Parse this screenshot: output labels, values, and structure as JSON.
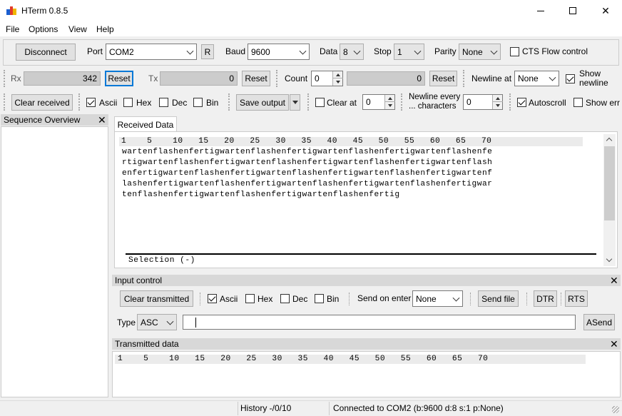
{
  "window": {
    "title": "HTerm 0.8.5",
    "minimize": "—",
    "maximize": "☐",
    "close": "✕"
  },
  "menu": [
    "File",
    "Options",
    "View",
    "Help"
  ],
  "connection": {
    "disconnect": "Disconnect",
    "port_label": "Port",
    "port_value": "COM2",
    "r_button": "R",
    "baud_label": "Baud",
    "baud_value": "9600",
    "data_label": "Data",
    "data_value": "8",
    "stop_label": "Stop",
    "stop_value": "1",
    "parity_label": "Parity",
    "parity_value": "None",
    "cts_label": "CTS Flow control",
    "cts_checked": false
  },
  "counters": {
    "rx_label": "Rx",
    "rx_value": "342",
    "rx_reset": "Reset",
    "tx_label": "Tx",
    "tx_value": "0",
    "tx_reset": "Reset",
    "count_label": "Count",
    "count_value": "0",
    "count_display": "0",
    "count_reset": "Reset",
    "newline_label": "Newline at",
    "newline_value": "None",
    "show_newline_label": "Show newline",
    "show_newline_checked": true
  },
  "receive_toolbar": {
    "clear_received": "Clear received",
    "ascii": "Ascii",
    "ascii_checked": true,
    "hex": "Hex",
    "dec": "Dec",
    "bin": "Bin",
    "save_output": "Save output",
    "clear_at_label": "Clear at",
    "clear_at_value": "0",
    "newline_every_label": "Newline every ... characters",
    "newline_every_value": "0",
    "autoscroll": "Autoscroll",
    "autoscroll_checked": true,
    "show_err": "Show err"
  },
  "sequence_overview": {
    "title": "Sequence Overview"
  },
  "received": {
    "tab": "Received Data",
    "ruler": "1    5    10   15   20   25   30   35   40   45   50   55   60   65   70",
    "lines": [
      "wartenflashenfertigwartenflashenfertigwartenflashenfertigwartenflashenfe",
      "rtigwartenflashenfertigwartenflashenfertigwartenflashenfertigwartenflash",
      "enfertigwartenflashenfertigwartenflashenfertigwartenflashenfertigwartenf",
      "lashenfertigwartenflashenfertigwartenflashenfertigwartenflashenfertigwar",
      "tenflashenfertigwartenflashenfertigwartenflashenfertig"
    ],
    "selection": "Selection (-)"
  },
  "input_control": {
    "title": "Input control",
    "clear_transmitted": "Clear transmitted",
    "ascii": "Ascii",
    "ascii_checked": true,
    "hex": "Hex",
    "dec": "Dec",
    "bin": "Bin",
    "send_on_enter_label": "Send on enter",
    "send_on_enter_value": "None",
    "send_file": "Send file",
    "dtr": "DTR",
    "rts": "RTS",
    "type_label": "Type",
    "type_value": "ASC",
    "input_value": "",
    "asend": "ASend"
  },
  "transmitted": {
    "title": "Transmitted data",
    "ruler": "1    5    10   15   20   25   30   35   40   45   50   55   60   65   70"
  },
  "status": {
    "history": "History -/0/10",
    "connection": "Connected to COM2 (b:9600 d:8 s:1 p:None)"
  }
}
